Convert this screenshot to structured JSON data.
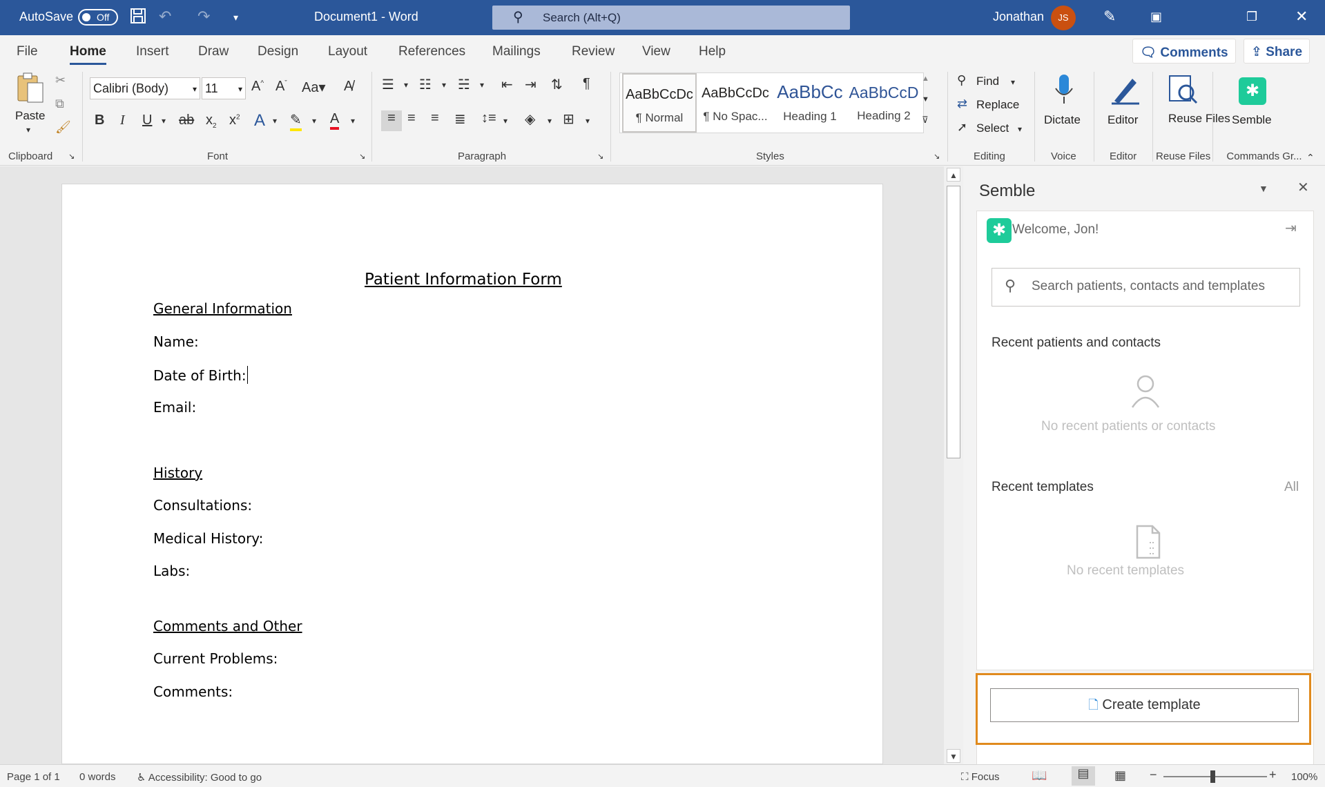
{
  "titlebar": {
    "autosave_label": "AutoSave",
    "autosave_state": "Off",
    "doc_title": "Document1  -  Word",
    "search_placeholder": "Search (Alt+Q)",
    "user_name": "Jonathan",
    "user_initials": "JS",
    "icons": [
      "save-icon",
      "undo-icon",
      "redo-icon",
      "customize-qat-icon",
      "pen-icon",
      "ribbon-display-icon",
      "restore-icon",
      "close-icon"
    ]
  },
  "tabs": [
    "File",
    "Home",
    "Insert",
    "Draw",
    "Design",
    "Layout",
    "References",
    "Mailings",
    "Review",
    "View",
    "Help"
  ],
  "active_tab": "Home",
  "ribbon_actions": {
    "comments": "Comments",
    "share": "Share"
  },
  "ribbon": {
    "paste_label": "Paste",
    "font_name": "Calibri (Body)",
    "font_size": "11",
    "styles": [
      {
        "preview": "AaBbCcDc",
        "name": "¶ Normal"
      },
      {
        "preview": "AaBbCcDc",
        "name": "¶ No Spac..."
      },
      {
        "preview": "AaBbCc",
        "name": "Heading 1"
      },
      {
        "preview": "AaBbCcD",
        "name": "Heading 2"
      }
    ],
    "editing": {
      "find": "Find",
      "replace": "Replace",
      "select": "Select"
    },
    "dictate": "Dictate",
    "editor": "Editor",
    "reuse_files": "Reuse Files",
    "semble": "Semble",
    "groups": {
      "clipboard": "Clipboard",
      "font": "Font",
      "paragraph": "Paragraph",
      "styles": "Styles",
      "editing": "Editing",
      "voice": "Voice",
      "editor": "Editor",
      "reuse_files": "Reuse Files",
      "commands": "Commands Gr..."
    }
  },
  "document": {
    "title": "Patient Information Form",
    "sections": [
      {
        "heading": "General Information",
        "fields": [
          "Name:",
          "Date of Birth:",
          "Email:"
        ]
      },
      {
        "heading": "History",
        "fields": [
          "Consultations:",
          "Medical History:",
          "Labs:"
        ]
      },
      {
        "heading": "Comments and Other",
        "fields": [
          "Current Problems:",
          "Comments:"
        ]
      }
    ]
  },
  "pane": {
    "title": "Semble",
    "welcome": "Welcome, Jon!",
    "search_placeholder": "Search patients, contacts and templates",
    "recent_patients_label": "Recent patients and contacts",
    "no_patients": "No recent patients or contacts",
    "recent_templates_label": "Recent templates",
    "all_link": "All",
    "no_templates": "No recent templates",
    "create_template": "Create template",
    "highlight_color": "#e08a1d",
    "brand_color": "#1ecb9a"
  },
  "status": {
    "page": "Page 1 of 1",
    "words": "0 words",
    "accessibility": "Accessibility: Good to go",
    "focus": "Focus",
    "zoom": "100%"
  },
  "colors": {
    "word_blue": "#2b579a"
  }
}
